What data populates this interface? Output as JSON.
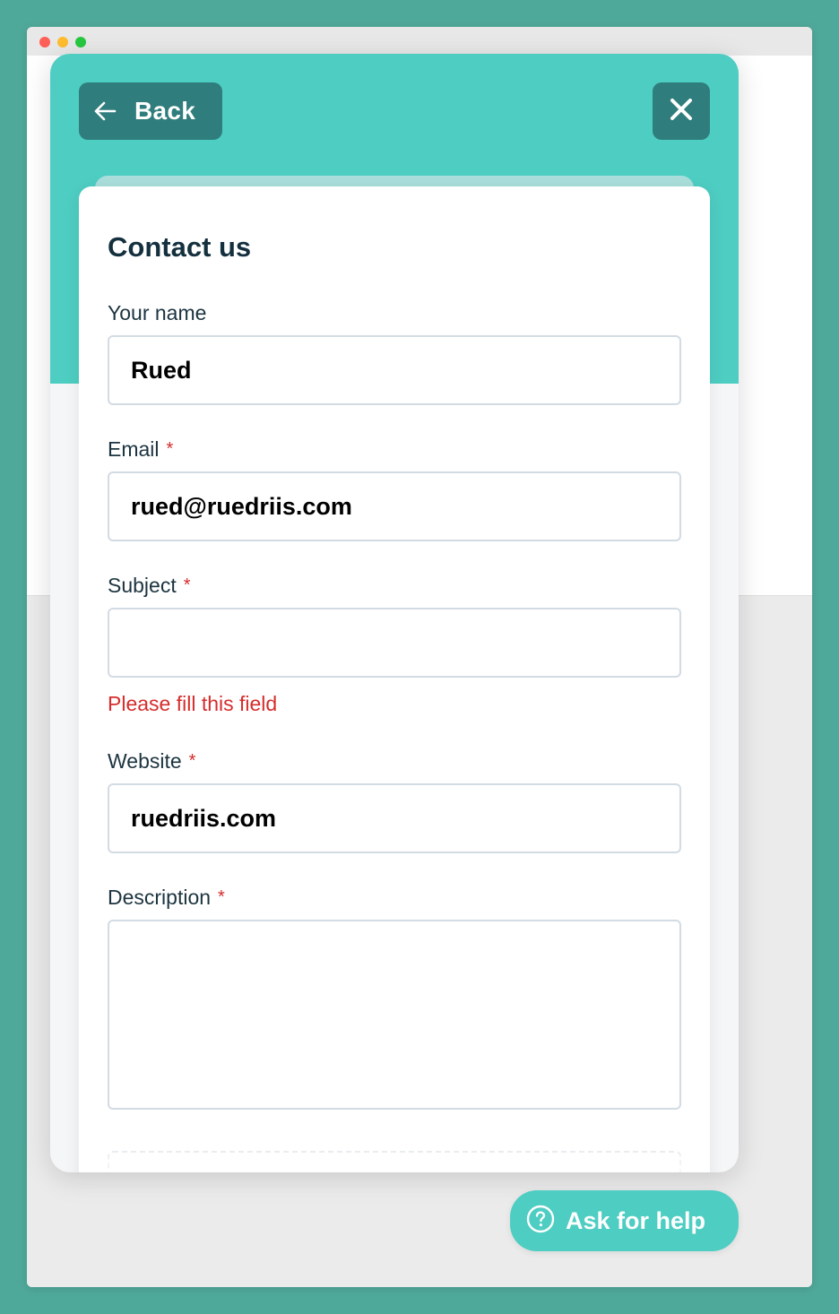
{
  "header": {
    "back_label": "Back"
  },
  "form": {
    "title": "Contact us",
    "required_marker": "*",
    "fields": {
      "name": {
        "label": "Your name",
        "value": "Rued",
        "placeholder": ""
      },
      "email": {
        "label": "Email",
        "value": "rued@ruedriis.com",
        "placeholder": ""
      },
      "subject": {
        "label": "Subject",
        "value": "",
        "placeholder": "",
        "error": "Please fill this field"
      },
      "website": {
        "label": "Website",
        "value": "ruedriis.com",
        "placeholder": ""
      },
      "description": {
        "label": "Description",
        "value": "",
        "placeholder": ""
      }
    }
  },
  "help": {
    "label": "Ask for help"
  },
  "colors": {
    "accent": "#4ecdc2",
    "button_dark": "#2f7d7c",
    "error": "#d62c2c",
    "title_text": "#14303e"
  },
  "icons": {
    "back": "arrow-left-icon",
    "close": "close-icon",
    "help": "question-circle-icon"
  }
}
